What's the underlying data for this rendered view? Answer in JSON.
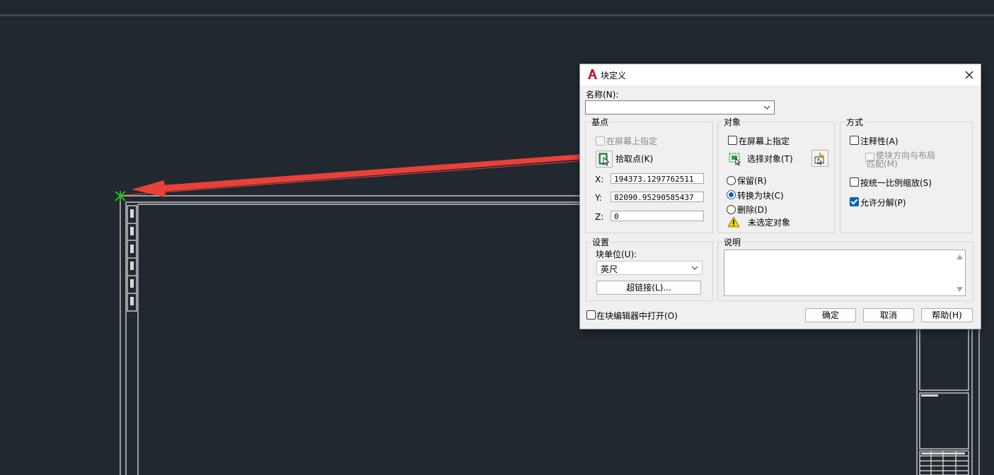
{
  "dialog": {
    "title": "块定义",
    "name_label": "名称(N):",
    "name_value": "",
    "base_point": {
      "title": "基点",
      "specify_on_screen": "在屏幕上指定",
      "pick_point": "拾取点(K)",
      "x_label": "X:",
      "y_label": "Y:",
      "z_label": "Z:",
      "x_value": "194373.1297762511",
      "y_value": "82090.95290585437",
      "z_value": "0"
    },
    "objects": {
      "title": "对象",
      "specify_on_screen": "在屏幕上指定",
      "select_objects": "选择对象(T)",
      "retain": "保留(R)",
      "convert_to_block": "转换为块(C)",
      "delete": "删除(D)",
      "no_objects_selected": "未选定对象"
    },
    "behavior": {
      "title": "方式",
      "annotative": "注释性(A)",
      "match_orientation_line1": "使块方向与布局",
      "match_orientation_line2": "匹配(M)",
      "scale_uniformly": "按统一比例缩放(S)",
      "allow_exploding": "允许分解(P)"
    },
    "settings": {
      "title": "设置",
      "block_unit_label": "块单位(U):",
      "block_unit_value": "英尺",
      "hyperlink_button": "超链接(L)..."
    },
    "description": {
      "title": "说明",
      "value": ""
    },
    "open_in_block_editor": "在块编辑器中打开(O)",
    "ok_button": "确定",
    "cancel_button": "取消",
    "help_button": "帮助(H)"
  },
  "icons": {
    "app": "autocad-a-icon",
    "close": "close-icon",
    "pick_point": "pick-point-icon",
    "select_objects": "select-objects-icon",
    "quick_select": "quick-select-icon",
    "warning": "warning-icon"
  },
  "colors": {
    "canvas_bg": "#212830",
    "arrow": "#e8413a",
    "marker": "#20c020",
    "accent": "#0a5fbd"
  }
}
